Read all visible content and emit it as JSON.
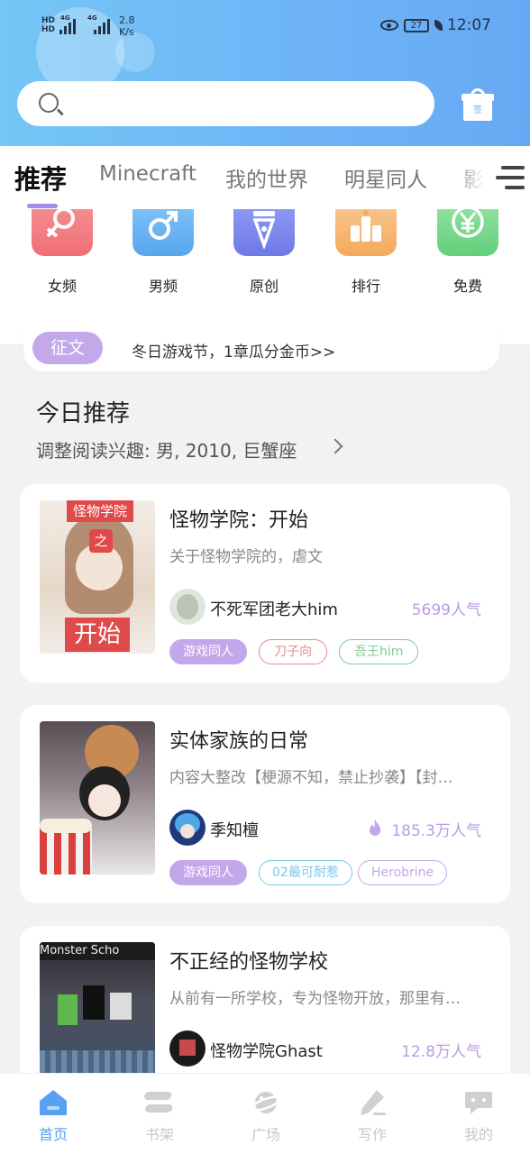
{
  "status_bar": {
    "sim1": "HD",
    "sim2": "HD",
    "net1": "4G",
    "net2": "4G",
    "speed_value": "2.8",
    "speed_unit": "K/s",
    "battery": "27",
    "time": "12:07"
  },
  "search": {
    "placeholder": "",
    "icon": "search-icon"
  },
  "sign_in": {
    "label": "签",
    "icon": "gift-icon"
  },
  "tabs": [
    {
      "label": "推荐",
      "active": true
    },
    {
      "label": "Minecraft",
      "active": false
    },
    {
      "label": "我的世界",
      "active": false
    },
    {
      "label": "明星同人",
      "active": false
    },
    {
      "label": "影视",
      "active": false
    }
  ],
  "categories": [
    {
      "label": "女频",
      "icon": "female-icon",
      "color": "#f3747d"
    },
    {
      "label": "男频",
      "icon": "male-icon",
      "color": "#62aef2"
    },
    {
      "label": "原创",
      "icon": "pen-nib-icon",
      "color": "#7b87ee"
    },
    {
      "label": "排行",
      "icon": "ranking-icon",
      "color": "#f6b56c"
    },
    {
      "label": "免费",
      "icon": "yen-icon",
      "color": "#73d789"
    }
  ],
  "notice": {
    "tag": "征文",
    "text": "冬日游戏节，1章瓜分金币>>"
  },
  "section": {
    "title": "今日推荐",
    "subtitle": "调整阅读兴趣: 男, 2010, 巨蟹座"
  },
  "books": [
    {
      "title": "怪物学院：开始",
      "desc": "关于怪物学院的，虐文",
      "author": "不死军团老大him",
      "popularity": "5699人气",
      "hot": false,
      "cover_text_top": "怪物学院",
      "cover_text_mid": "之",
      "cover_text_bottom": "开始",
      "tags": [
        {
          "label": "游戏同人",
          "style": "fill",
          "color": "#c4a6ea"
        },
        {
          "label": "刀子向",
          "style": "outline",
          "color": "#e88a8a"
        },
        {
          "label": "吾王him",
          "style": "outline",
          "color": "#7fcb8e"
        }
      ]
    },
    {
      "title": "实体家族的日常",
      "desc": "内容大整改【梗源不知，禁止抄袭】【封…",
      "author": "季知檀",
      "popularity": "185.3万人气",
      "hot": true,
      "tags": [
        {
          "label": "游戏同人",
          "style": "fill",
          "color": "#c4a6ea"
        },
        {
          "label": "02最可耐惹",
          "style": "outline",
          "color": "#76c9e6"
        },
        {
          "label": "Herobrine",
          "style": "outline",
          "color": "#c4a6ea"
        }
      ]
    },
    {
      "title": "不正经的怪物学校",
      "desc": "从前有一所学校，专为怪物开放，那里有…",
      "author": "怪物学院Ghast",
      "popularity": "12.8万人气",
      "hot": false,
      "cover_text_top": "Monster Scho",
      "tags": []
    }
  ],
  "bottom_nav": [
    {
      "label": "首页",
      "icon": "home-icon",
      "active": true
    },
    {
      "label": "书架",
      "icon": "bookshelf-icon",
      "active": false
    },
    {
      "label": "广场",
      "icon": "planet-icon",
      "active": false
    },
    {
      "label": "写作",
      "icon": "pen-icon",
      "active": false
    },
    {
      "label": "我的",
      "icon": "chat-bubble-icon",
      "active": false
    }
  ]
}
